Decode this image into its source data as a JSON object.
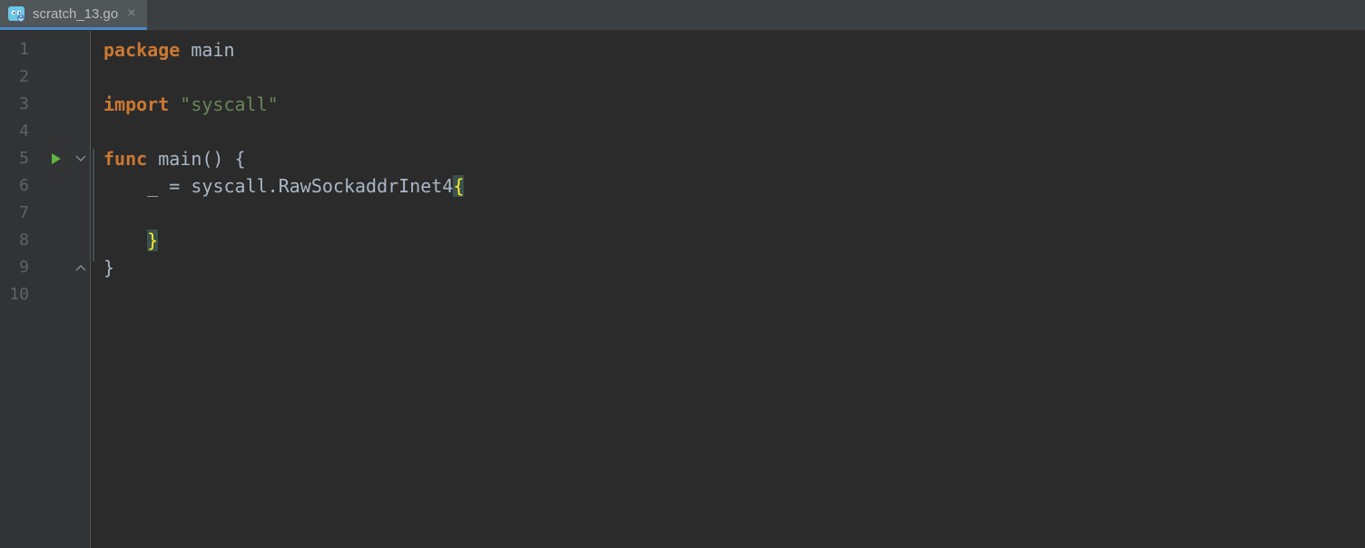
{
  "tab": {
    "filename": "scratch_13.go"
  },
  "lineNumbers": [
    "1",
    "2",
    "3",
    "4",
    "5",
    "6",
    "7",
    "8",
    "9",
    "10"
  ],
  "code": {
    "line1": {
      "kw": "package",
      "name": "main"
    },
    "line3": {
      "kw": "import",
      "str": "\"syscall\""
    },
    "line5": {
      "kw": "func",
      "name": "main",
      "parens": "()",
      "brace": "{"
    },
    "line6": {
      "blank": "_",
      "eq": "=",
      "pkg": "syscall",
      "dot": ".",
      "type": "RawSockaddrInet4",
      "brace": "{"
    },
    "line8": {
      "brace": "}"
    },
    "line9": {
      "brace": "}"
    }
  }
}
